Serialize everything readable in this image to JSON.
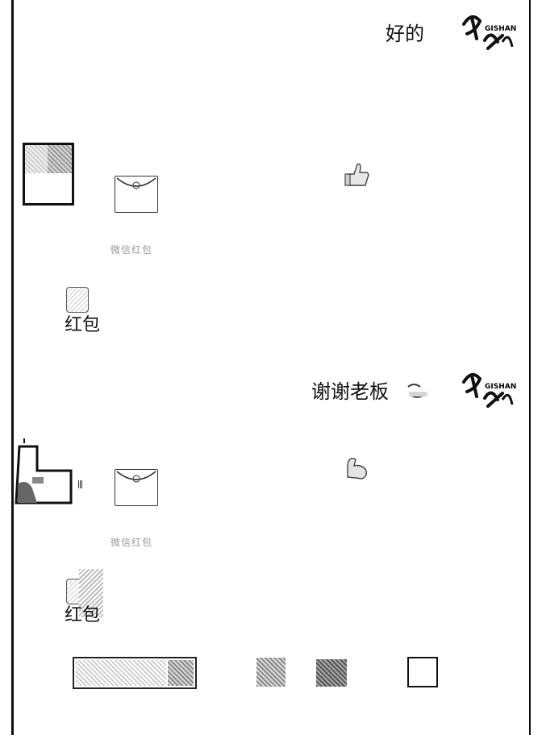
{
  "chat": {
    "messages": [
      {
        "side": "right",
        "text": "好的",
        "brand": "GISHAN"
      },
      {
        "side": "left",
        "type": "red-packet",
        "caption": "微信红包",
        "label": "红包",
        "reaction_icon": "thumbs-up-icon"
      },
      {
        "side": "right",
        "text": "谢谢老板",
        "emoji_icon": "wink-face-icon",
        "brand": "GISHAN"
      },
      {
        "side": "left",
        "type": "red-packet",
        "caption": "微信红包",
        "label": "红包",
        "reaction_icon": "flexed-bicep-icon"
      }
    ]
  },
  "toolbar": {
    "input_placeholder": "",
    "buttons": [
      "voice-button",
      "emoji-button",
      "more-button",
      "send-square-button"
    ]
  }
}
